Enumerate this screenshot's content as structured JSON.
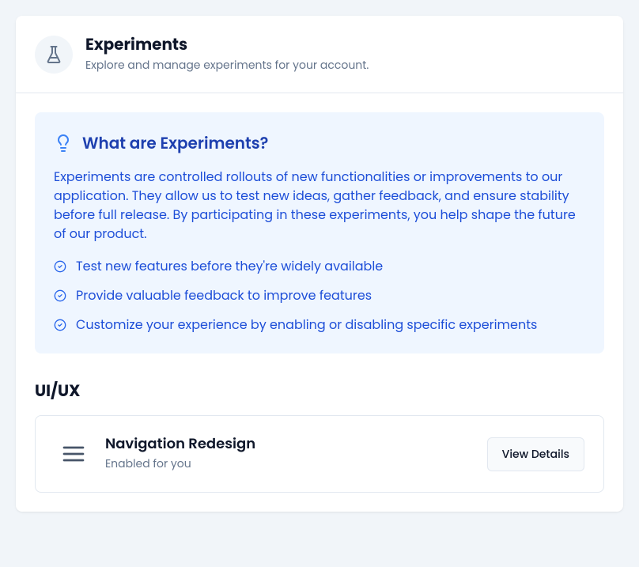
{
  "header": {
    "title": "Experiments",
    "subtitle": "Explore and manage experiments for your account."
  },
  "info_box": {
    "title": "What are Experiments?",
    "description": "Experiments are controlled rollouts of new functionalities or improvements to our application. They allow us to test new ideas, gather feedback, and ensure stability before full release. By participating in these experiments, you help shape the future of our product.",
    "items": [
      "Test new features before they're widely available",
      "Provide valuable feedback to improve features",
      "Customize your experience by enabling or disabling specific experiments"
    ]
  },
  "sections": [
    {
      "title": "UI/UX",
      "experiments": [
        {
          "name": "Navigation Redesign",
          "status": "Enabled for you",
          "button_label": "View Details"
        }
      ]
    }
  ]
}
